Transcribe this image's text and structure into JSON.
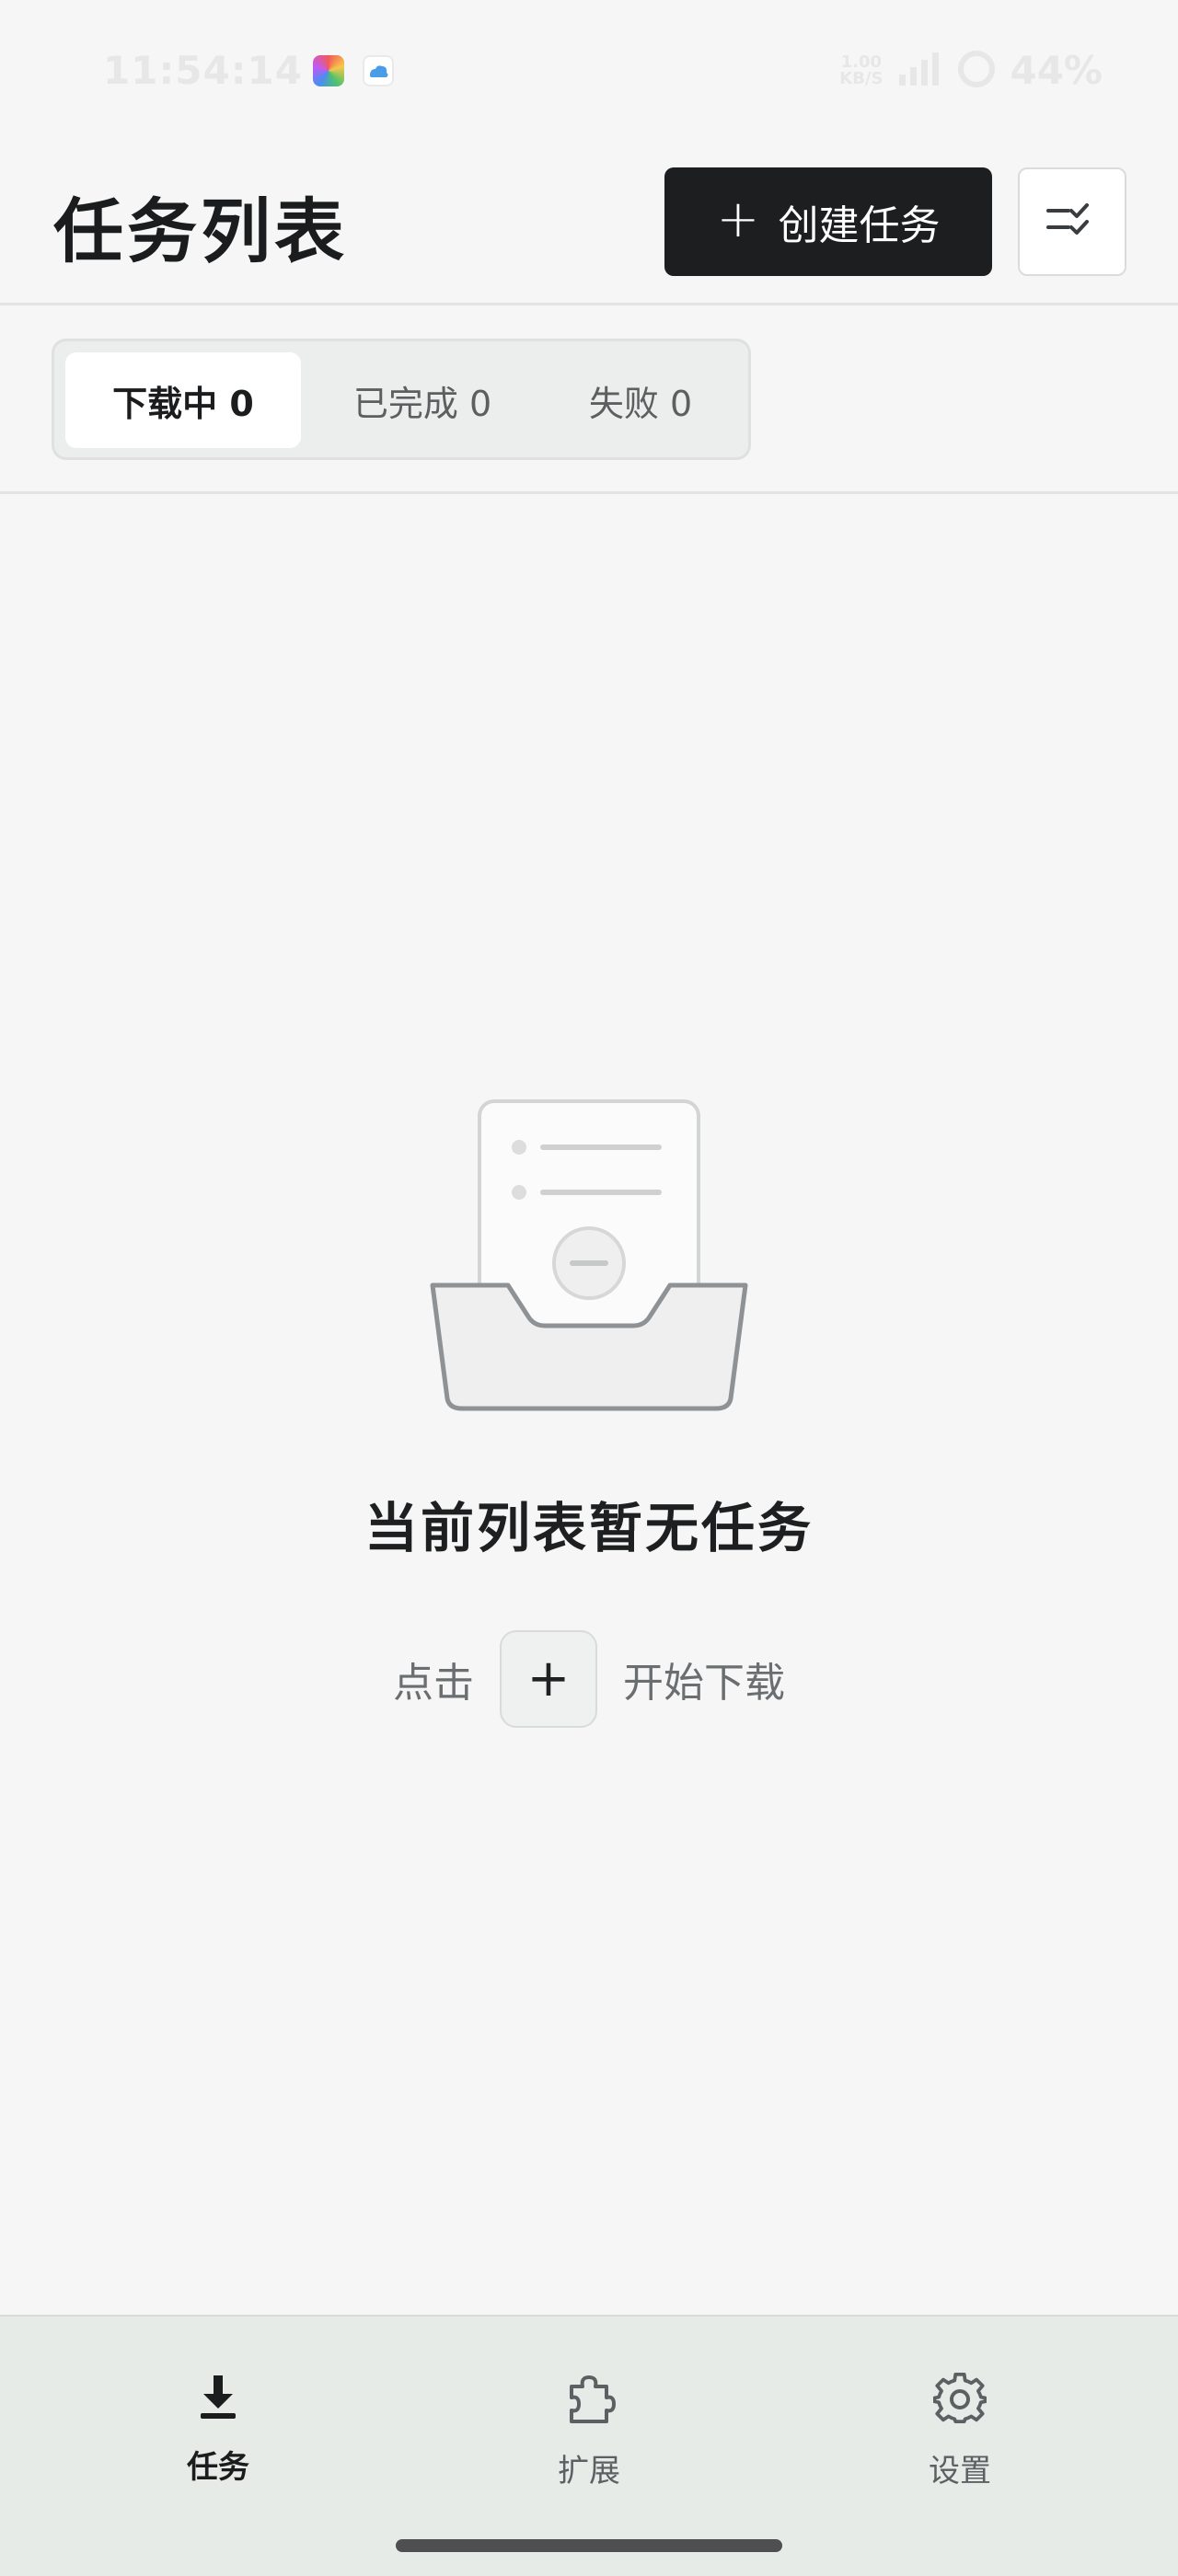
{
  "status_bar": {
    "time": "11:54:14",
    "net_speed_value": "1.00",
    "net_speed_unit": "KB/S",
    "battery": "44%"
  },
  "header": {
    "title": "任务列表",
    "create_button_label": "创建任务",
    "create_button_icon": "plus-icon",
    "filter_icon": "list-check-icon"
  },
  "tabs": [
    {
      "label": "下载中 0",
      "active": true
    },
    {
      "label": "已完成 0",
      "active": false
    },
    {
      "label": "失败 0",
      "active": false
    }
  ],
  "empty_state": {
    "title": "当前列表暂无任务",
    "hint_before": "点击",
    "hint_button": "+",
    "hint_after": "开始下载"
  },
  "bottom_nav": [
    {
      "label": "任务",
      "icon": "download-icon",
      "active": true
    },
    {
      "label": "扩展",
      "icon": "puzzle-icon",
      "active": false
    },
    {
      "label": "设置",
      "icon": "gear-icon",
      "active": false
    }
  ],
  "colors": {
    "background": "#f5f6f5",
    "primary_button": "#1c1e20",
    "nav_background": "#e7ebe8",
    "text_primary": "#1b1c1d",
    "text_secondary": "#6b6e70"
  }
}
